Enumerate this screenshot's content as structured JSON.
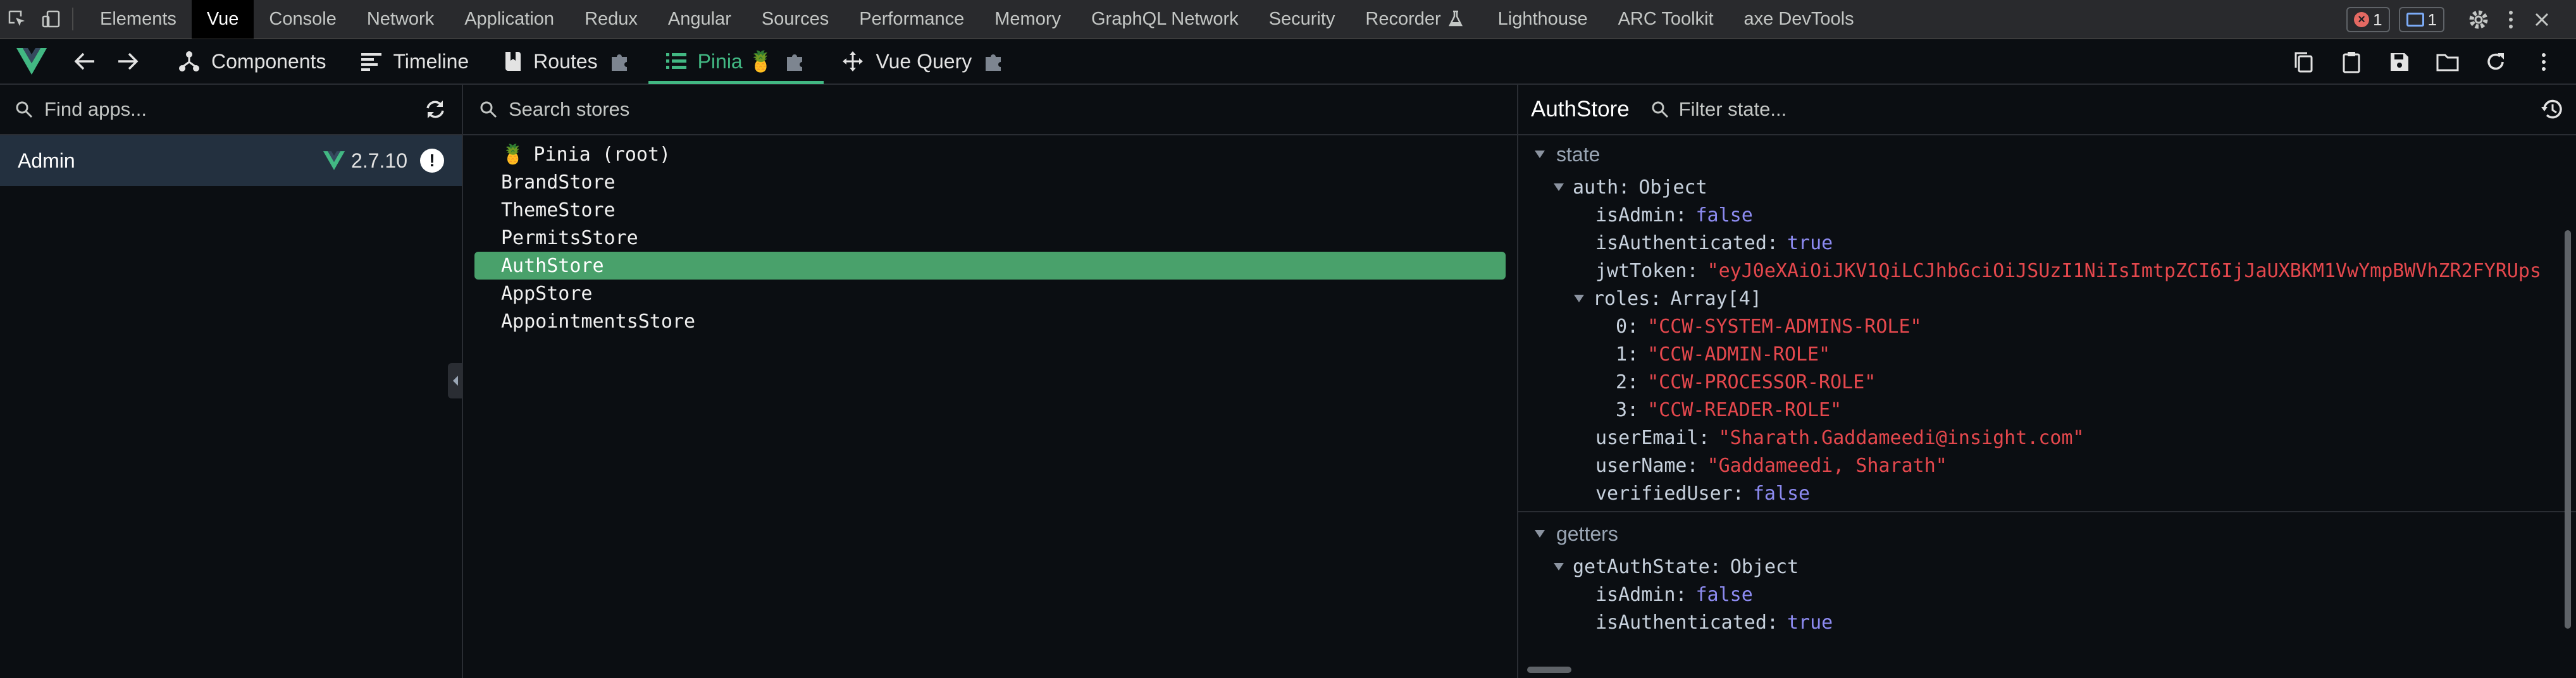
{
  "devtools": {
    "tabs": [
      {
        "label": "Elements",
        "active": false
      },
      {
        "label": "Vue",
        "active": true
      },
      {
        "label": "Console",
        "active": false
      },
      {
        "label": "Network",
        "active": false
      },
      {
        "label": "Application",
        "active": false
      },
      {
        "label": "Redux",
        "active": false
      },
      {
        "label": "Angular",
        "active": false
      },
      {
        "label": "Sources",
        "active": false
      },
      {
        "label": "Performance",
        "active": false
      },
      {
        "label": "Memory",
        "active": false
      },
      {
        "label": "GraphQL Network",
        "active": false
      },
      {
        "label": "Security",
        "active": false
      },
      {
        "label": "Recorder",
        "active": false
      },
      {
        "label": "Lighthouse",
        "active": false
      },
      {
        "label": "ARC Toolkit",
        "active": false
      },
      {
        "label": "axe DevTools",
        "active": false
      }
    ],
    "error_count": "1",
    "message_count": "1"
  },
  "vue_toolbar": {
    "tabs": [
      {
        "label": "Components",
        "icon": "component-tree-icon",
        "active": false
      },
      {
        "label": "Timeline",
        "icon": "timeline-icon",
        "active": false
      },
      {
        "label": "Routes",
        "icon": "routes-icon",
        "active": false
      },
      {
        "label": "Pinia",
        "icon": "pinia-list-icon",
        "active": true
      },
      {
        "label": "Vue Query",
        "icon": "vue-query-icon",
        "active": false
      }
    ]
  },
  "apps": {
    "search_placeholder": "Find apps...",
    "items": [
      {
        "name": "Admin",
        "version": "2.7.10",
        "selected": true
      }
    ]
  },
  "stores": {
    "search_placeholder": "Search stores",
    "items": [
      {
        "name": "Pinia (root)",
        "selected": false,
        "root": true
      },
      {
        "name": "BrandStore",
        "selected": false
      },
      {
        "name": "ThemeStore",
        "selected": false
      },
      {
        "name": "PermitsStore",
        "selected": false
      },
      {
        "name": "AuthStore",
        "selected": true
      },
      {
        "name": "AppStore",
        "selected": false
      },
      {
        "name": "AppointmentsStore",
        "selected": false
      }
    ]
  },
  "inspector": {
    "title": "AuthStore",
    "filter_placeholder": "Filter state...",
    "state": {
      "label": "state",
      "auth": {
        "key": "auth",
        "type": "Object"
      },
      "isAdmin": {
        "key": "isAdmin",
        "value": "false"
      },
      "isAuthenticated": {
        "key": "isAuthenticated",
        "value": "true"
      },
      "jwtToken": {
        "key": "jwtToken",
        "value": "\"eyJ0eXAiOiJKV1QiLCJhbGciOiJSUzI1NiIsImtpZCI6IjJaUXBKM1VwYmpBWVhZR2FYRUps"
      },
      "roles": {
        "key": "roles",
        "type": "Array[4]"
      },
      "role_items": [
        {
          "index": "0",
          "value": "\"CCW-SYSTEM-ADMINS-ROLE\""
        },
        {
          "index": "1",
          "value": "\"CCW-ADMIN-ROLE\""
        },
        {
          "index": "2",
          "value": "\"CCW-PROCESSOR-ROLE\""
        },
        {
          "index": "3",
          "value": "\"CCW-READER-ROLE\""
        }
      ],
      "userEmail": {
        "key": "userEmail",
        "value": "\"Sharath.Gaddameedi@insight.com\""
      },
      "userName": {
        "key": "userName",
        "value": "\"Gaddameedi, Sharath\""
      },
      "verifiedUser": {
        "key": "verifiedUser",
        "value": "false"
      }
    },
    "getters": {
      "label": "getters",
      "getAuthState": {
        "key": "getAuthState",
        "type": "Object"
      },
      "isAdmin": {
        "key": "isAdmin",
        "value": "false"
      },
      "isAuthenticated": {
        "key": "isAuthenticated",
        "value": "true"
      }
    }
  },
  "colors": {
    "vue_green": "#42b883",
    "selected_store_bg": "#49a16b",
    "boolean": "#8d8bf1",
    "string": "#e5484d",
    "selected_app_bg": "#23303f"
  }
}
